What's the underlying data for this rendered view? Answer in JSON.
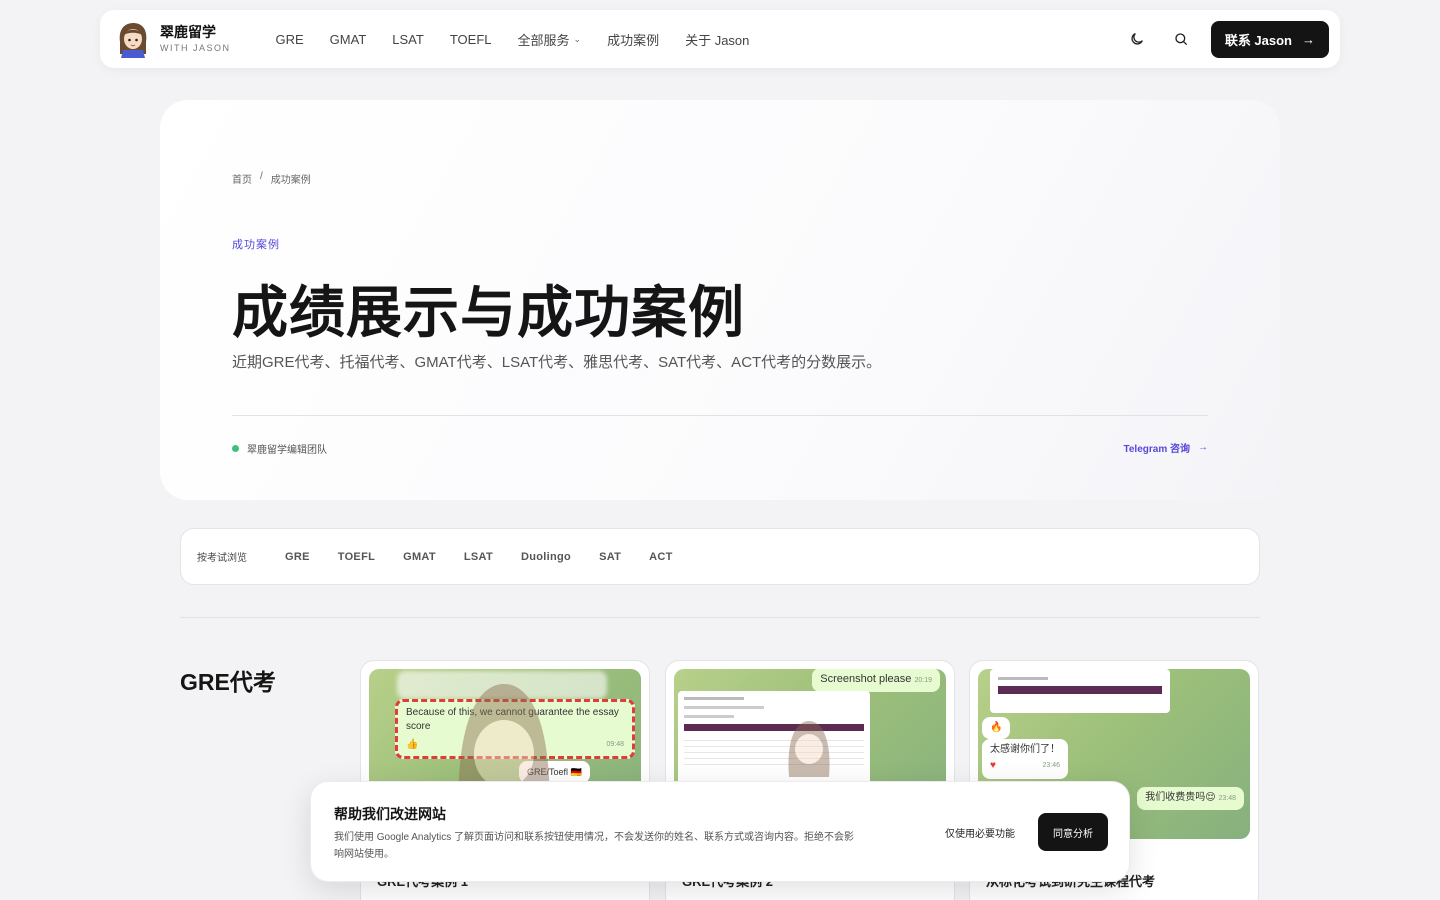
{
  "brand": {
    "name": "翠鹿留学",
    "sub": "WITH JASON"
  },
  "nav": {
    "links": [
      {
        "label": "GRE"
      },
      {
        "label": "GMAT"
      },
      {
        "label": "LSAT"
      },
      {
        "label": "TOEFL"
      },
      {
        "label": "全部服务"
      },
      {
        "label": "成功案例"
      },
      {
        "label": "关于 Jason"
      }
    ],
    "contact_label": "联系 Jason"
  },
  "breadcrumb": {
    "home": "首页",
    "sep": "/",
    "current": "成功案例"
  },
  "hero": {
    "eyebrow": "成功案例",
    "title": "成绩展示与成功案例",
    "desc": "近期GRE代考、托福代考、GMAT代考、LSAT代考、雅思代考、SAT代考、ACT代考的分数展示。",
    "author": "翠鹿留学编辑团队",
    "telegram_label": "Telegram 咨询"
  },
  "filter": {
    "label": "按考试浏览",
    "tags": [
      "GRE",
      "TOEFL",
      "GMAT",
      "LSAT",
      "Duolingo",
      "SAT",
      "ACT"
    ]
  },
  "gre_section": {
    "title": "GRE代考",
    "cards": [
      {
        "msg1": "Because of this, we cannot guarantee the essay score",
        "time1": "09:48",
        "msg2": "GRE/Toefl 🇩🇪",
        "caption": "GRE代考案例 1"
      },
      {
        "msg1": "Screenshot please",
        "time1": "20:19",
        "caption": "GRE代考案例 2"
      },
      {
        "msg1": "太感谢你们了！",
        "time1": "23:46",
        "msg2": "我们收费贵吗😌",
        "time2": "23:48",
        "caption": "从标化考试到研究生课程代考"
      }
    ]
  },
  "cookie": {
    "title": "帮助我们改进网站",
    "text": "我们使用 Google Analytics 了解页面访问和联系按钮使用情况，不会发送你的姓名、联系方式或咨询内容。拒绝不会影响网站使用。",
    "necessary_label": "仅使用必要功能",
    "accept_label": "同意分析"
  },
  "colors": {
    "accent": "#5548d9",
    "dark": "#141414",
    "green_dot": "#3fbf7f"
  }
}
